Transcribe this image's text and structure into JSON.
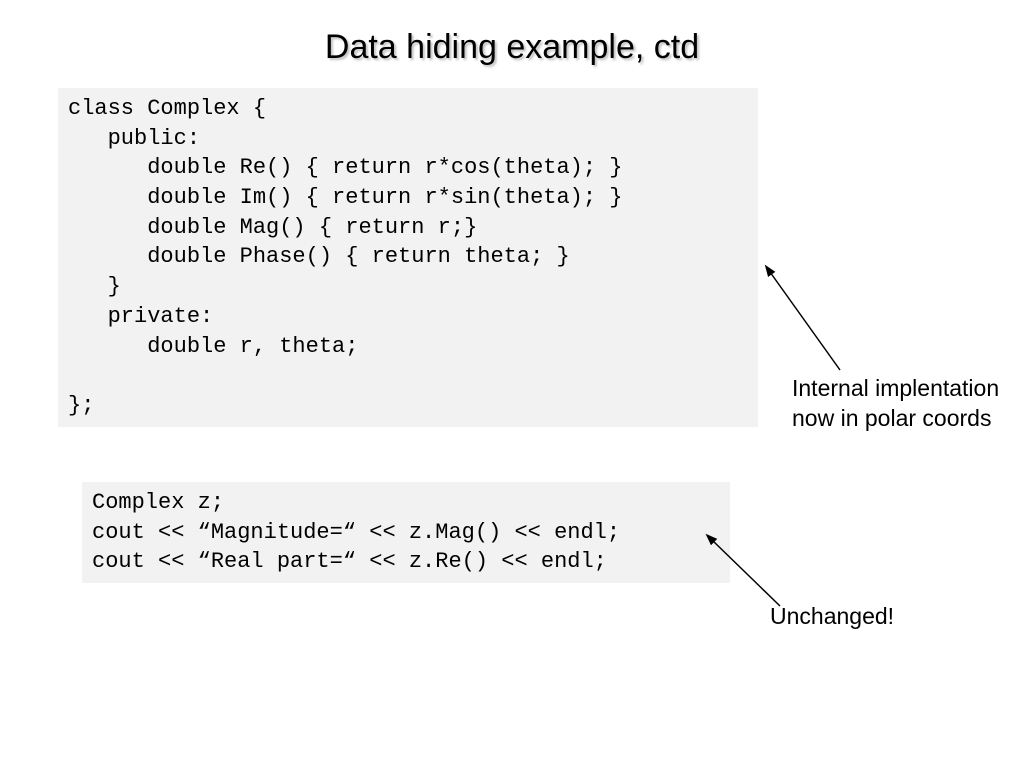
{
  "title": "Data hiding example, ctd",
  "code_lines_top": [
    "class Complex {",
    "   public:",
    "      double Re() { return r*cos(theta); }",
    "      double Im() { return r*sin(theta); }",
    "      double Mag() { return r;}",
    "      double Phase() { return theta; }",
    "   }",
    "   private:",
    "      double r, theta;",
    "",
    "};"
  ],
  "code_lines_bottom": [
    "Complex z;",
    "cout << “Magnitude=“ << z.Mag() << endl;",
    "cout << “Real part=“ << z.Re() << endl;"
  ],
  "annotation_right_line1": "Internal implentation",
  "annotation_right_line2": "now in polar coords",
  "annotation_lower": "Unchanged!"
}
